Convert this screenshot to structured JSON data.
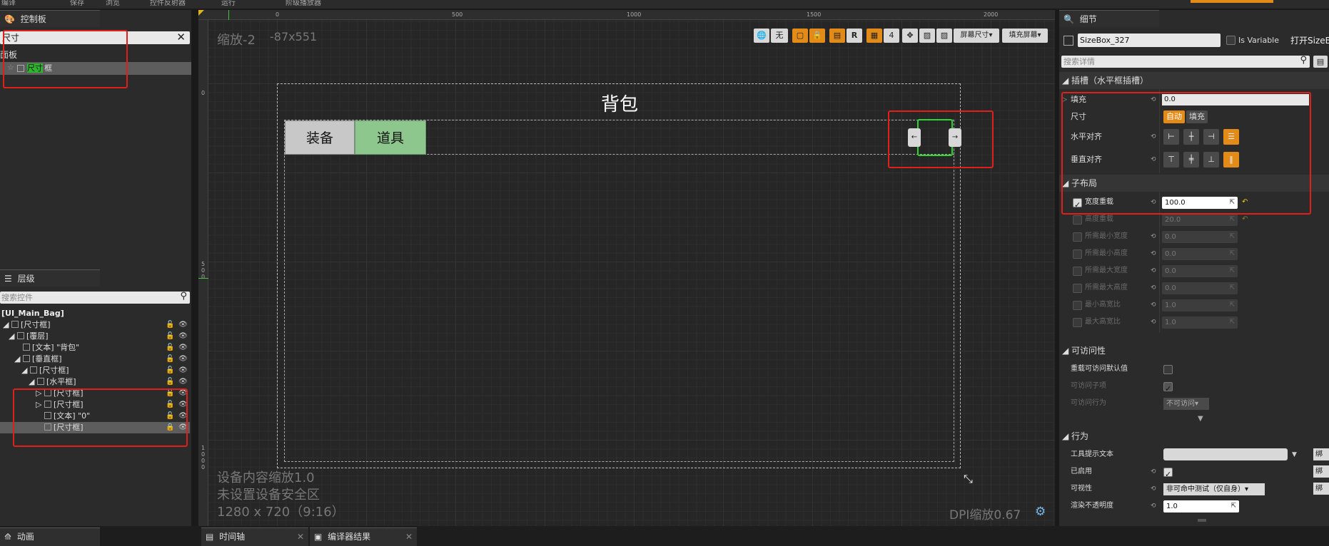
{
  "menubar": {
    "items": [
      "编译",
      "保存",
      "浏览",
      "控件反射器",
      "运行",
      "阶级播放器"
    ]
  },
  "palette": {
    "tab_title": "控制板",
    "search_value": "尺寸",
    "category": "面板",
    "item_label": "尺寸框",
    "item_highlight": "尺寸"
  },
  "hierarchy": {
    "tab_title": "层级",
    "search_placeholder": "搜索控件",
    "root": "[UI_Main_Bag]",
    "rows": [
      {
        "label": "[尺寸框]"
      },
      {
        "label": "[覆层]"
      },
      {
        "label": "[文本] \"背包\""
      },
      {
        "label": "[垂直框]"
      },
      {
        "label": "[尺寸框]"
      },
      {
        "label": "[水平框]"
      },
      {
        "label": "[尺寸框]"
      },
      {
        "label": "[尺寸框]"
      },
      {
        "label": "[文本] \"0\""
      },
      {
        "label": "[尺寸框]"
      }
    ]
  },
  "canvas": {
    "zoom_label": "缩放-2",
    "coords_label": "-87x551",
    "ruler_top": [
      "0",
      "500",
      "1000",
      "1500",
      "2000"
    ],
    "ruler_left": [
      "0",
      "5\n0\n0",
      "1\n0\n0\n0"
    ],
    "title_text": "背包",
    "tab_equip": "装备",
    "tab_items": "道具",
    "arrow_left": "←",
    "arrow_right": "→",
    "info_line1": "设备内容缩放1.0",
    "info_line2": "未设置设备安全区",
    "info_line3": "1280 x 720（9:16）",
    "dpi_label": "DPI缩放0.67",
    "toolbar": {
      "btn_none": "无",
      "btn_r": "R",
      "btn_4": "4",
      "screen_size": "屏幕尺寸▾",
      "fill_screen": "填充屏幕▾"
    }
  },
  "details": {
    "tab_title": "细节",
    "widget_name": "SizeBox_327",
    "is_variable": "Is Variable",
    "open_btn": "打开SizeBox",
    "search_placeholder": "搜索详情",
    "section_slot": "插槽（水平框插槽）",
    "fill_label": "填充",
    "fill_value": "0.0",
    "size_label": "尺寸",
    "size_auto": "自动",
    "size_fill": "填充",
    "halign_label": "水平对齐",
    "valign_label": "垂直对齐",
    "section_child": "子布局",
    "child_rows": [
      {
        "label": "宽度重载",
        "value": "100.0",
        "enabled": true
      },
      {
        "label": "高度重载",
        "value": "20.0",
        "enabled": false
      },
      {
        "label": "所需最小宽度",
        "value": "0.0",
        "enabled": false
      },
      {
        "label": "所需最小高度",
        "value": "0.0",
        "enabled": false
      },
      {
        "label": "所需最大宽度",
        "value": "0.0",
        "enabled": false
      },
      {
        "label": "所需最大高度",
        "value": "0.0",
        "enabled": false
      },
      {
        "label": "最小高宽比",
        "value": "1.0",
        "enabled": false
      },
      {
        "label": "最大高宽比",
        "value": "1.0",
        "enabled": false
      }
    ],
    "section_access": "可访问性",
    "override_access": "重载可访问默认值",
    "access_children": "可访问子项",
    "access_behavior": "可访问行为",
    "access_behavior_value": "不可访问▾",
    "section_behavior": "行为",
    "tooltip_label": "工具提示文本",
    "enabled_label": "已启用",
    "visibility_label": "可视性",
    "visibility_value": "非可命中测试（仅自身）▾",
    "opacity_label": "渲染不透明度",
    "opacity_value": "1.0",
    "bind_label": "绑定"
  },
  "bottom_tabs": {
    "animation": "动画",
    "timeline": "时间轴",
    "compiler": "编译器结果"
  }
}
